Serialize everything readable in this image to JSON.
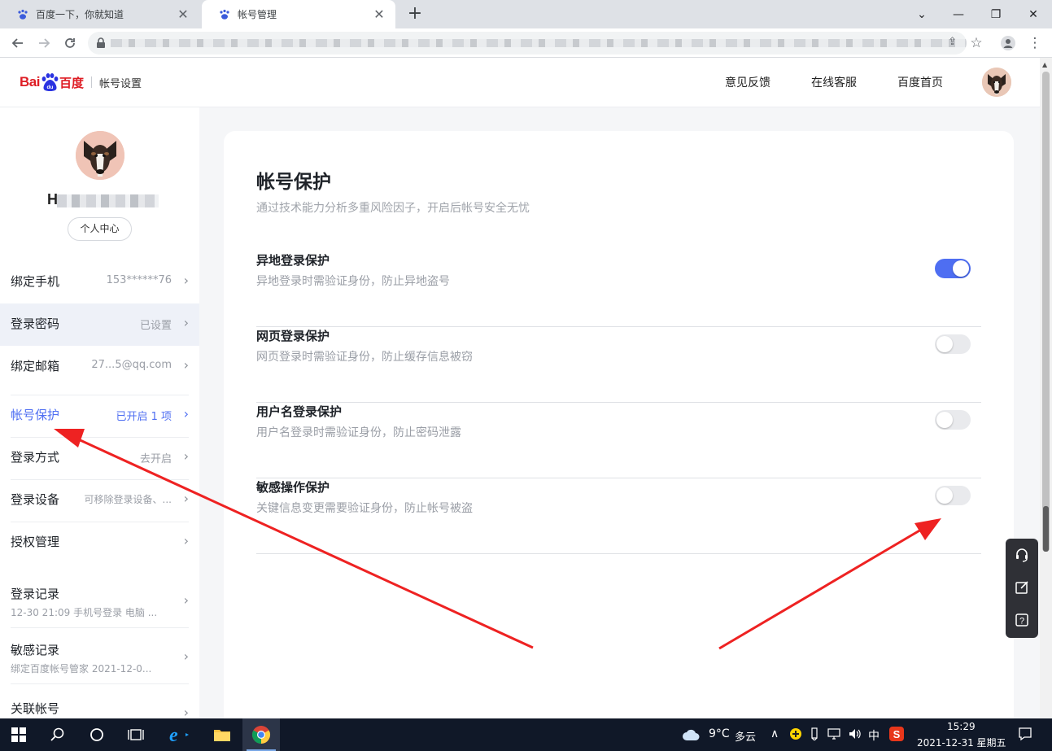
{
  "browser": {
    "tabs": [
      {
        "label": "百度一下，你就知道",
        "active": false
      },
      {
        "label": "帐号管理",
        "active": true
      }
    ],
    "new_tab": "+",
    "controls": {
      "dropdown": "⌄",
      "minimize": "—",
      "restore": "❐",
      "close": "✕"
    }
  },
  "header": {
    "logo": {
      "bai": "Bai",
      "cn": "百度",
      "subtitle": "帐号设置"
    },
    "nav": [
      "意见反馈",
      "在线客服",
      "百度首页"
    ]
  },
  "sidebar": {
    "personal_center": "个人中心",
    "items": [
      {
        "label": "绑定手机",
        "value": "153******76"
      },
      {
        "label": "登录密码",
        "value": "已设置",
        "active": true
      },
      {
        "label": "绑定邮箱",
        "value": "27...5@qq.com"
      },
      {
        "label": "帐号保护",
        "value": "已开启 1 项",
        "highlight": true
      },
      {
        "label": "登录方式",
        "value": "去开启"
      },
      {
        "label": "登录设备",
        "value": "可移除登录设备、..."
      },
      {
        "label": "授权管理",
        "value": ""
      },
      {
        "label": "登录记录",
        "sub": "12-30 21:09 手机号登录 电脑 ..."
      },
      {
        "label": "敏感记录",
        "sub": "绑定百度帐号管家 2021-12-0..."
      },
      {
        "label": "关联帐号",
        "value": ""
      }
    ]
  },
  "main": {
    "title": "帐号保护",
    "description": "通过技术能力分析多重风险因子，开启后帐号安全无忧",
    "protections": [
      {
        "title": "异地登录保护",
        "desc": "异地登录时需验证身份，防止异地盗号",
        "enabled": true
      },
      {
        "title": "网页登录保护",
        "desc": "网页登录时需验证身份，防止缓存信息被窃",
        "enabled": false
      },
      {
        "title": "用户名登录保护",
        "desc": "用户名登录时需验证身份，防止密码泄露",
        "enabled": false
      },
      {
        "title": "敏感操作保护",
        "desc": "关键信息变更需要验证身份，防止帐号被盗",
        "enabled": false
      }
    ]
  },
  "taskbar": {
    "weather": "9°C",
    "weather_desc": "多云",
    "ime": "中",
    "time": "15:29",
    "date": "2021-12-31 星期五"
  },
  "colors": {
    "accent": "#4e6ef2",
    "brand_red": "#de1d24",
    "arrow": "#ee2222"
  }
}
